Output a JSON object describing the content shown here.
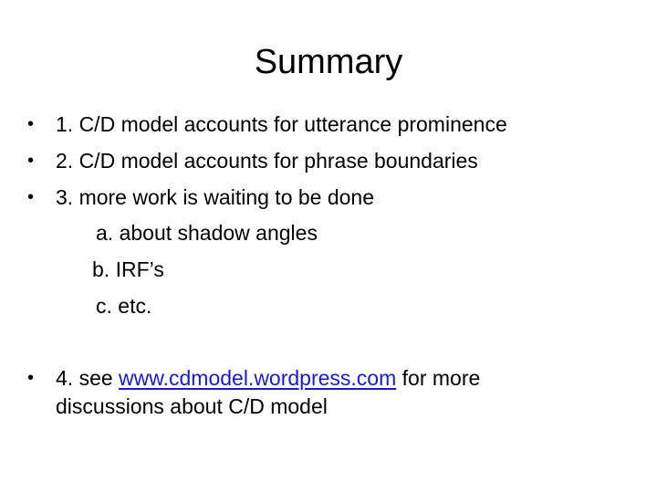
{
  "slide": {
    "title": "Summary",
    "bullets": [
      {
        "marker": "•",
        "text": "1. C/D model accounts for utterance prominence"
      },
      {
        "marker": "•",
        "text": "2. C/D model accounts for phrase boundaries"
      },
      {
        "marker": "•",
        "text": "3. more work is waiting to be done"
      }
    ],
    "sub_items": [
      {
        "text": "a. about shadow angles"
      },
      {
        "text": "b. IRF’s"
      },
      {
        "text": "c. etc."
      }
    ],
    "last_bullet": {
      "marker": "•",
      "prefix": "4. see ",
      "link_text": "www.cdmodel.wordpress.com",
      "suffix": " for more",
      "continuation": "discussions about C/D model"
    },
    "colors": {
      "text": "#000000",
      "link": "#1a1acc",
      "background": "#ffffff"
    }
  }
}
